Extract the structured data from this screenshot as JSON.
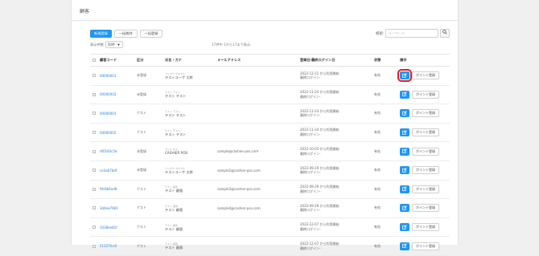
{
  "page": {
    "title": "顧客"
  },
  "toolbar": {
    "buttons": [
      {
        "label": "新規登録"
      },
      {
        "label": "一括削除"
      },
      {
        "label": "一括登録"
      }
    ]
  },
  "search": {
    "label": "検索:",
    "placeholder": "キーワード",
    "icon": "search-icon"
  },
  "pagination": {
    "size_label": "表示件数",
    "size_value": "50件",
    "count_text": "17件中 1から17まで表示"
  },
  "table": {
    "headers": [
      "顧客コード",
      "区分",
      "氏名・カナ",
      "メールアドレス",
      "登録日/最終ログイン日",
      "状態",
      "操作"
    ],
    "edit_icon": "edit-icon",
    "point_label": "ポイント登録",
    "rows": [
      {
        "code": "00000001",
        "type": "未登録",
        "kana": "フリガナ カキクケ",
        "name": "テストユーザ 太郎",
        "email": "",
        "reg1": "2022-12-21 から利用開始",
        "reg2": "最終ログイン-",
        "status": "有効",
        "highlight": true
      },
      {
        "code": "00000002",
        "type": "未登録",
        "kana": "テスト テスト",
        "name": "テスト テスト",
        "email": "",
        "reg1": "2022-11-24 から利用開始",
        "reg2": "最終ログイン-",
        "status": "有効",
        "highlight": false
      },
      {
        "code": "00000003",
        "type": "ゲスト",
        "kana": "テスト テスト",
        "name": "テスト テスト",
        "email": "",
        "reg1": "2022-11-24 から利用開始",
        "reg2": "最終ログイン-",
        "status": "有効",
        "highlight": false
      },
      {
        "code": "00000005",
        "type": "ゲスト",
        "kana": "テスト テスト",
        "name": "テスト テスト",
        "email": "",
        "reg1": "2022-11-24 から利用開始",
        "reg2": "最終ログイン-",
        "status": "有効",
        "highlight": false
      },
      {
        "code": "df0540c5d",
        "type": "未登録",
        "kana": "カシエ ポス",
        "name": "CASHIER POS",
        "email": "sample@cashier-pos.com",
        "reg1": "2022-10-05 から利用開始",
        "reg2": "最終ログイン-",
        "status": "有効",
        "highlight": false
      },
      {
        "code": "ce3a67bdf",
        "type": "未登録",
        "kana": "フリガナ カキクケ",
        "name": "テストユーザ 太郎",
        "email": "sample2@cashier-pos.com",
        "reg1": "2022-09-29 から利用開始",
        "reg2": "最終ログイン-",
        "status": "有効",
        "highlight": false
      },
      {
        "code": "9fc8b6ad8",
        "type": "ゲスト",
        "kana": "テスト 顧客",
        "name": "テスト 顧客",
        "email": "sample3@cashier-pos.com",
        "reg1": "2022-09-29 から利用開始",
        "reg2": "最終ログイン-",
        "status": "有効",
        "highlight": false
      },
      {
        "code": "3d4ee79b5",
        "type": "ゲスト",
        "kana": "テスト 顧客",
        "name": "テスト 顧客",
        "email": "sample4@cashier-pos.com",
        "reg1": "2022-09-29 から利用開始",
        "reg2": "最終ログイン-",
        "status": "有効",
        "highlight": false
      },
      {
        "code": "1038ee81f",
        "type": "ゲスト",
        "kana": "テスト 顧客",
        "name": "テスト 顧客",
        "email": "",
        "reg1": "2022-12-07 から利用開始",
        "reg2": "最終ログイン-",
        "status": "有効",
        "highlight": false
      },
      {
        "code": "51227fce5",
        "type": "ゲスト",
        "kana": "テスト 顧客",
        "name": "テスト 顧客",
        "email": "",
        "reg1": "2022-12-07 から利用開始",
        "reg2": "最終ログイン-",
        "status": "有効",
        "highlight": false
      }
    ]
  },
  "colors": {
    "primary": "#2196f3",
    "link": "#2d7fd3",
    "highlight": "#e21e1e"
  }
}
